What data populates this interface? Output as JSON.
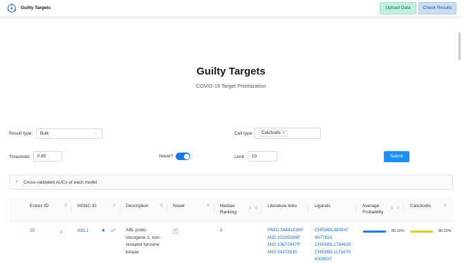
{
  "header": {
    "app_title": "Guilty Targets",
    "upload_label": "Upload Data",
    "check_label": "Check Results",
    "logo_icon": "network-globe-icon"
  },
  "hero": {
    "title": "Guilty Targets",
    "subtitle": "COVID-19 Target Prioritization"
  },
  "form": {
    "result_type_label": "Result type:",
    "result_type_value": "Bulk",
    "cell_type_label": "Cell type:",
    "cell_type_tag": "Calu3cells",
    "threshold_label": "Threshold:",
    "threshold_value": "0.85",
    "novel_label": "Novel?",
    "novel_on": true,
    "limit_label": "Limit:",
    "limit_value": "10",
    "submit_label": "Submit"
  },
  "collapse": {
    "label": "Cross-validated AUCs of each model"
  },
  "table": {
    "headers": {
      "entrez": "Entrez ID",
      "hgnc": "HGNC ID",
      "description": "Description",
      "novel": "Novel",
      "median_ranking_1": "Median",
      "median_ranking_2": "Ranking",
      "literature": "Literature links",
      "ligands": "Ligands",
      "avg_prob_1": "Average",
      "avg_prob_2": "Probability",
      "calu3": "Calu3cells"
    },
    "rows": [
      {
        "entrez": "25",
        "hgnc": "ABL1",
        "description": [
          "ABL proto-",
          "oncogene 1, non-",
          "receptor tyrosine",
          "kinase"
        ],
        "novel_checked": true,
        "median_ranking": "1",
        "literature": [
          "PMID:34441436P",
          "MID:32335089P",
          "MID:33672947P",
          "MID:34372615"
        ],
        "ligands": [
          "CHEMBL483847",
          "9977819",
          "CHEMBL1784630",
          "CHEMBL1171679",
          "6328537"
        ],
        "avg_probability": "86.32%",
        "avg_probability_value": 0.8632,
        "avg_probability_color": "#1677ff",
        "calu3": "86.32%",
        "calu3_value": 0.8632,
        "calu3_color": "#d4d41a"
      }
    ]
  }
}
